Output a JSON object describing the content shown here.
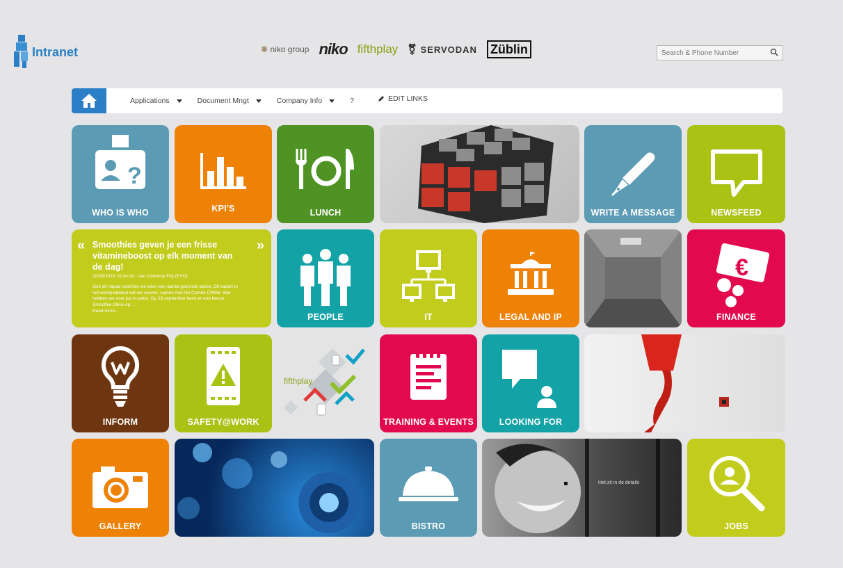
{
  "header": {
    "logo_text": "Intranet",
    "brands": [
      "niko group",
      "niko",
      "fifthplay",
      "SERVODAN",
      "Züblin"
    ],
    "search_placeholder": "Search & Phone Number"
  },
  "nav": {
    "items": [
      {
        "label": "Applications",
        "has_dropdown": true
      },
      {
        "label": "Document Mngt",
        "has_dropdown": true
      },
      {
        "label": "Company Info",
        "has_dropdown": true
      },
      {
        "label": "?",
        "has_dropdown": false
      }
    ],
    "edit_links": "EDIT LINKS"
  },
  "tiles": {
    "who_is_who": "WHO IS WHO",
    "kpis": "KPI'S",
    "lunch": "LUNCH",
    "write_message": "WRITE A MESSAGE",
    "newsfeed": "NEWSFEED",
    "people": "PEOPLE",
    "it": "IT",
    "legal": "LEGAL AND IP",
    "finance": "FINANCE",
    "inform": "INFORM",
    "safety": "SAFETY@WORK",
    "fifthplay_tile": "fifthplay",
    "training": "TRAINING & EVENTS",
    "looking_for": "LOOKING FOR",
    "gallery": "GALLERY",
    "bistro": "BISTRO",
    "jobs": "JOBS",
    "photo_caption": "Het zit in de details"
  },
  "news": {
    "title": "Smoothies geven je een frisse vitamineboost op elk moment van de dag!",
    "meta": "20/08/2015 15:34:24 - Van Overloop Elly (EVO)",
    "body": "Ook dit najaar voorzien we weer een aantal gezonde acties. Dit kadert in het welzijnsbeleid dat we voeren, samen met het Comité CPBW. Wat hebben we voor jou in petto: Op 23 september komt er een heuse Smoothie Clinic op ...",
    "read_more": "Read more..."
  },
  "colors": {
    "steel_blue": "#5b9bb4",
    "orange": "#ee8206",
    "green": "#4f9325",
    "lime": "#c2cc1d",
    "yellow_green": "#a9c214",
    "teal": "#13a3a6",
    "magenta": "#e2094f",
    "brown": "#6d3611",
    "brand_blue": "#2a7fc6"
  }
}
